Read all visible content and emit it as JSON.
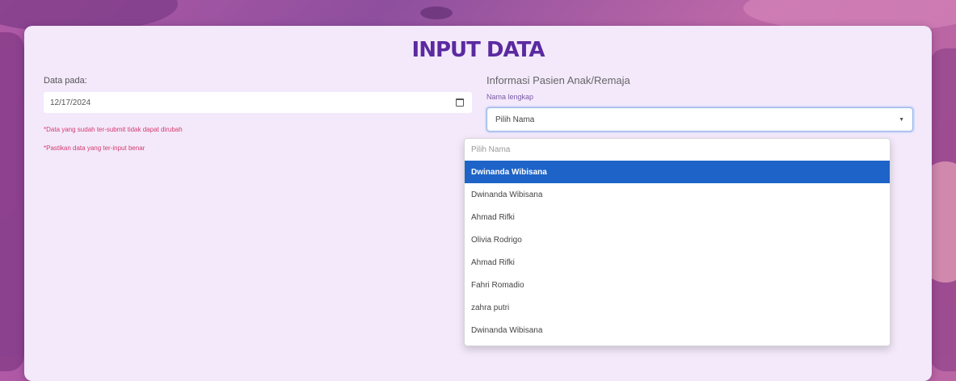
{
  "form": {
    "title": "INPUT DATA",
    "date_label": "Data pada:",
    "date_value": "12/17/2024",
    "warning_1": "*Data yang sudah ter-submit tidak dapat dirubah",
    "warning_2": "*Pastikan data yang ter-input benar"
  },
  "patient": {
    "section_title": "Informasi Pasien Anak/Remaja",
    "name_label": "Nama lengkap",
    "select_value": "Pilih Nama"
  },
  "dropdown": {
    "placeholder": "Pilih Nama",
    "selected_index": 0,
    "options": [
      "Dwinanda Wibisana",
      "Dwinanda Wibisana",
      "Ahmad Rifki",
      "Olivia Rodrigo",
      "Ahmad Rifki",
      "Fahri Romadio",
      "zahra putri",
      "Dwinanda Wibisana"
    ]
  },
  "colors": {
    "accent": "#5b2aa0",
    "warning": "#d63a6e",
    "selected": "#1e64c8"
  }
}
